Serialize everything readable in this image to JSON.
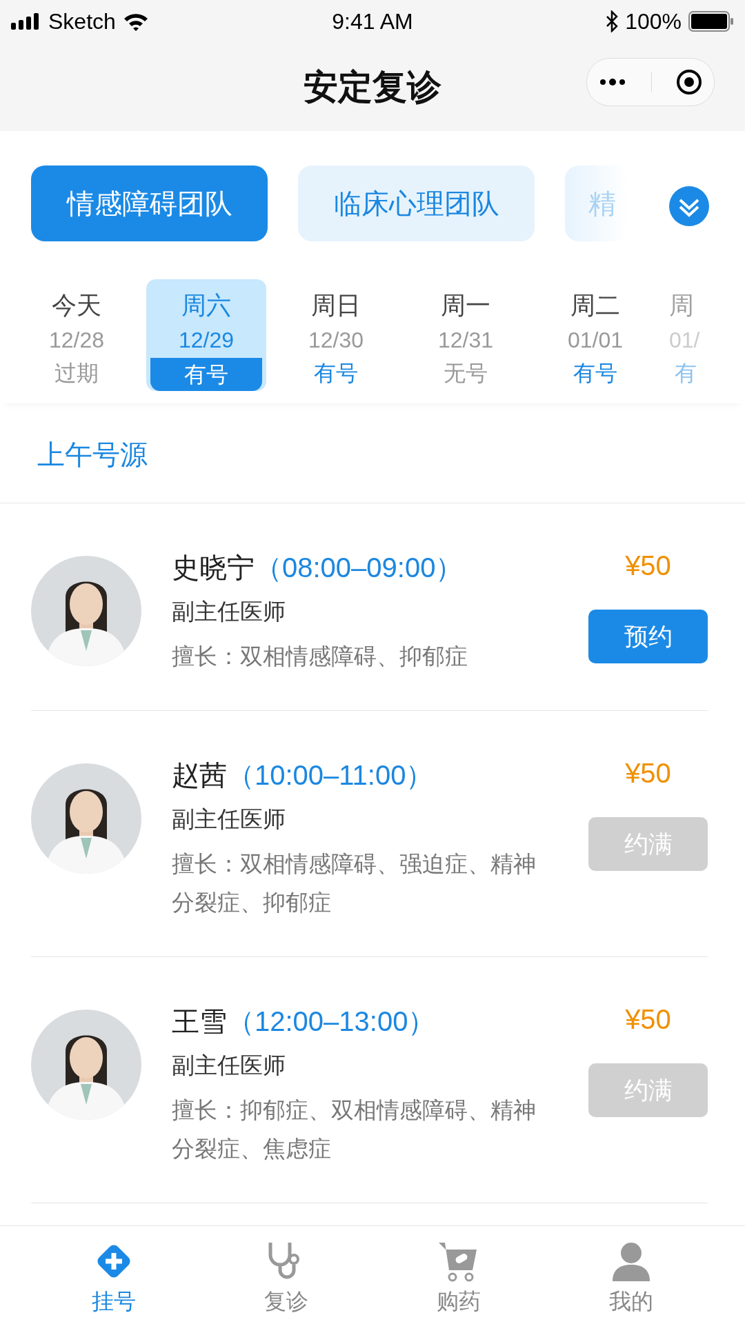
{
  "status_bar": {
    "carrier": "Sketch",
    "time": "9:41 AM",
    "battery": "100%"
  },
  "nav": {
    "title": "安定复诊"
  },
  "teams": [
    {
      "label": "情感障碍团队",
      "selected": true
    },
    {
      "label": "临床心理团队",
      "selected": false
    },
    {
      "label": "精",
      "selected": false
    }
  ],
  "dates": [
    {
      "day": "今天",
      "date": "12/28",
      "status": "过期",
      "kind": "past",
      "selected": false
    },
    {
      "day": "周六",
      "date": "12/29",
      "status": "有号",
      "kind": "available",
      "selected": true
    },
    {
      "day": "周日",
      "date": "12/30",
      "status": "有号",
      "kind": "available",
      "selected": false
    },
    {
      "day": "周一",
      "date": "12/31",
      "status": "无号",
      "kind": "none",
      "selected": false
    },
    {
      "day": "周二",
      "date": "01/01",
      "status": "有号",
      "kind": "available",
      "selected": false
    },
    {
      "day": "周",
      "date": "01/",
      "status": "有",
      "kind": "available",
      "selected": false
    }
  ],
  "section": "上午号源",
  "doctors": [
    {
      "name": "史晓宁",
      "time": "（08:00–09:00）",
      "title": "副主任医师",
      "specialty": "擅长：双相情感障碍、抑郁症",
      "price": "¥50",
      "button": "预约",
      "disabled": false
    },
    {
      "name": "赵茜",
      "time": "（10:00–11:00）",
      "title": "副主任医师",
      "specialty": "擅长：双相情感障碍、强迫症、精神分裂症、抑郁症",
      "price": "¥50",
      "button": "约满",
      "disabled": true
    },
    {
      "name": "王雪",
      "time": "（12:00–13:00）",
      "title": "副主任医师",
      "specialty": "擅长：抑郁症、双相情感障碍、精神分裂症、焦虑症",
      "price": "¥50",
      "button": "约满",
      "disabled": true
    }
  ],
  "tabbar": [
    {
      "label": "挂号",
      "kind": "register",
      "selected": true
    },
    {
      "label": "复诊",
      "kind": "revisit",
      "selected": false
    },
    {
      "label": "购药",
      "kind": "pharmacy",
      "selected": false
    },
    {
      "label": "我的",
      "kind": "profile",
      "selected": false
    }
  ]
}
